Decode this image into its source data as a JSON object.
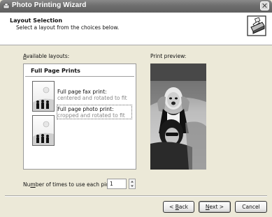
{
  "window": {
    "title": "Photo Printing Wizard",
    "close_glyph": "✕",
    "icon": "printer-wizard-icon"
  },
  "header": {
    "title": "Layout Selection",
    "subtitle": "Select a layout from the choices below.",
    "icon": "printer-icon"
  },
  "layouts": {
    "label_prefix": "A",
    "label_rest": "vailable layouts:",
    "group_title": "Full Page Prints",
    "items": [
      {
        "title": "Full page fax print:",
        "desc": "centered and rotated to fit",
        "icon": "layout-thumbnail-icon"
      },
      {
        "title": "Full page photo print:",
        "desc": "cropped and rotated to fit",
        "icon": "layout-thumbnail-icon"
      }
    ]
  },
  "preview": {
    "label": "Print preview:"
  },
  "copies": {
    "label_pre": "Nu",
    "label_u": "m",
    "label_post": "ber of times to use each picture:",
    "value": "1"
  },
  "buttons": {
    "back_pre": "< ",
    "back_u": "B",
    "back_post": "ack",
    "next_u": "N",
    "next_post": "ext >",
    "cancel": "Cancel"
  }
}
